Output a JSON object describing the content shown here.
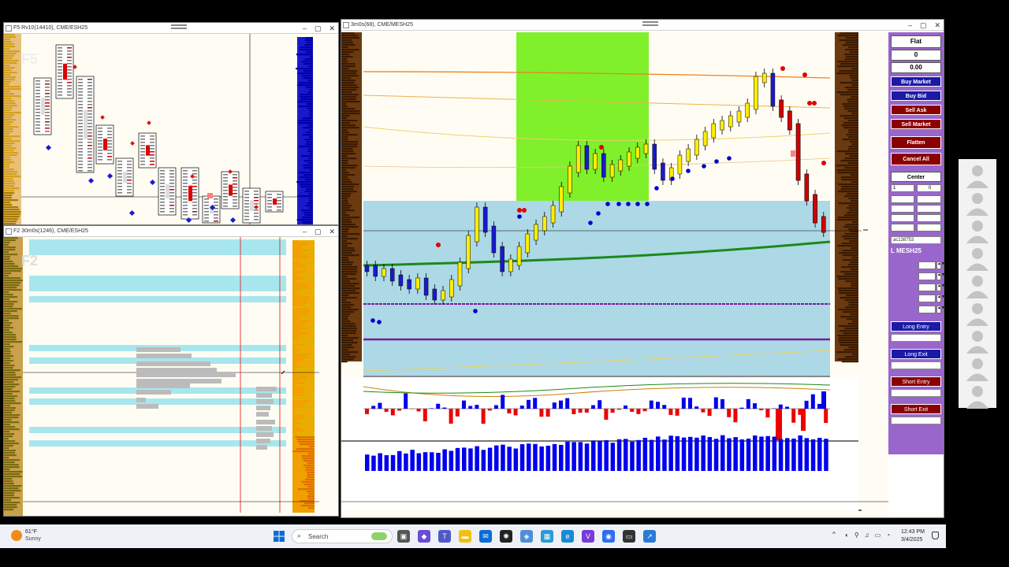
{
  "windows": {
    "top_left": {
      "title": "F5 Rv10(14410), CME/ESH25",
      "watermark": "F5"
    },
    "mid_left": {
      "title": "F2 30m0s(1246), CME/ESH25",
      "watermark": "F2"
    },
    "main": {
      "title": "3m0s(68), CME/MESH25"
    }
  },
  "top_left_chart": {
    "price_axis": [
      "5834.75",
      "5832.25",
      "5829.75",
      "5827.00",
      "5825.75",
      "5824.50"
    ],
    "annotations": [
      "[429]",
      "[173]",
      "[114]",
      "[35]",
      "[-20]",
      "[45]",
      "[-282]",
      "[-82]"
    ]
  },
  "mid_left_chart": {
    "price_axis": [
      "5847.25",
      "5836.25",
      "5825.75",
      "5814.25",
      "5803.25",
      "5792.25"
    ],
    "level_labels": [
      "5855.25",
      "5849.75",
      "5843.25",
      "5832.25",
      "5828.00",
      "5821.75",
      "5817.25",
      "5812.50",
      "5806.75"
    ],
    "x_labels": [
      [
        "18:00",
        "03/02"
      ],
      [
        "09:30",
        "03/03"
      ],
      [
        "18:00",
        "03/03"
      ],
      [
        "09:30",
        "03/04"
      ]
    ],
    "tpo_col1": [
      "M N",
      "M N",
      "M N",
      "M N",
      "M N",
      "M N",
      "M N",
      "M N",
      "M N",
      "M N",
      "M N",
      "M N",
      "M N",
      "M N",
      "M N",
      "M N",
      "M N",
      "M N",
      "M N",
      "M N",
      "M N",
      "M N",
      "M N",
      "N",
      "N",
      "N",
      "N"
    ],
    "tpo_col2": [
      "m r s t v",
      "r s t v w",
      "r s t v w",
      "r s t v",
      "r s v w",
      "w",
      "w",
      "w",
      "w",
      "w",
      "w",
      "w x A",
      "w x A",
      "w x A",
      "w x A",
      "w x y z A",
      "w x y z A",
      "w x y z A",
      "w x y z A",
      "v x y z A",
      "y z A",
      "y z A",
      "y z",
      "y z",
      "y z",
      "v"
    ],
    "tpo_col3": [
      "M N",
      "L M N",
      "L M N",
      "K L M N",
      "K L M N",
      "K L M N",
      "K L M N",
      "K L M N",
      "K L N",
      "K L N",
      "K L N",
      "K L N",
      "K L N",
      "K L N",
      "K L N",
      "J K L N",
      "J K N",
      "J K N",
      "B I J K N",
      "B I J N",
      "B I J",
      "B I J",
      "B I J",
      "B I J",
      "B I J",
      "B I J",
      "B I J",
      "B G I J",
      "B G I J",
      "B G H I J",
      "B G H I J",
      "B G H I J",
      "B G H I J",
      "B G H I J",
      "B G H I J"
    ]
  },
  "main_chart": {
    "price_axis": [
      "5867.25",
      "5845.25",
      "5822.75",
      "5812.50",
      "5808.00",
      "5801.00",
      "5778.75",
      "5770.50",
      "5756.75"
    ],
    "current_price": "5822.75",
    "tag_5812": "5812.50",
    "tag_5808": "5808.00",
    "tag_5770": "5770.50",
    "x_labels": [
      "12:27",
      "12:39",
      "12:51",
      "13:03",
      "13:12",
      "13:21",
      "13:33",
      "13:45",
      "13:57",
      "14:06",
      "14:15",
      "14:27",
      "14:36",
      "14:48",
      "15:00",
      "15:12",
      "15:24",
      "15:33",
      "15:42"
    ],
    "x_date": "03/04",
    "time_box": "03/04 15:42",
    "delta_axis": [
      "13326",
      "896",
      "-896",
      "-5792",
      "-2689"
    ],
    "delta_values": [
      "978537",
      "1945429",
      "966892"
    ],
    "vol_axis": [
      "1315",
      "420",
      "-420",
      "-840",
      "-1260"
    ],
    "vol_values": [
      "6956",
      "12918",
      "5962"
    ]
  },
  "trade_panel": {
    "status": "Flat",
    "position": "0",
    "pnl": "0.00",
    "buttons": [
      "Buy Market",
      "Buy Bid",
      "Sell Ask",
      "Sell Market",
      "Flatten",
      "Cancel All",
      "Center"
    ],
    "qty": "1",
    "qty2": "0",
    "np_label": "NP",
    "clr_label": "CLR",
    "grid": [
      [
        "1",
        "2"
      ],
      [
        "4",
        "8"
      ],
      [
        "10",
        "20"
      ]
    ],
    "account": "ac138753",
    "instrument": "L MESH25",
    "fields": [
      {
        "label": "Target",
        "value": "0"
      },
      {
        "label": "Stop",
        "value": "20"
      },
      {
        "label": "BE at",
        "value": "15"
      },
      {
        "label": "BE +",
        "value": "2"
      },
      {
        "label": "Trail",
        "value": "0"
      }
    ],
    "strategy_buttons": [
      "Long Entry",
      "Long Exit",
      "Short Entry",
      "Short Exit"
    ]
  },
  "taskbar": {
    "weather_temp": "61°F",
    "weather_desc": "Sunny",
    "search_placeholder": "Search",
    "time": "12:43 PM",
    "date": "3/4/2025"
  },
  "colors": {
    "bull": "#ffee00",
    "bear": "#d00000",
    "value_area": "#add8e6",
    "highlight": "#7ff02a",
    "panel": "#9966cc",
    "vwap": "#1a8a1a",
    "buy_vol": "#0000ee",
    "sell_vol": "#ee0000"
  }
}
